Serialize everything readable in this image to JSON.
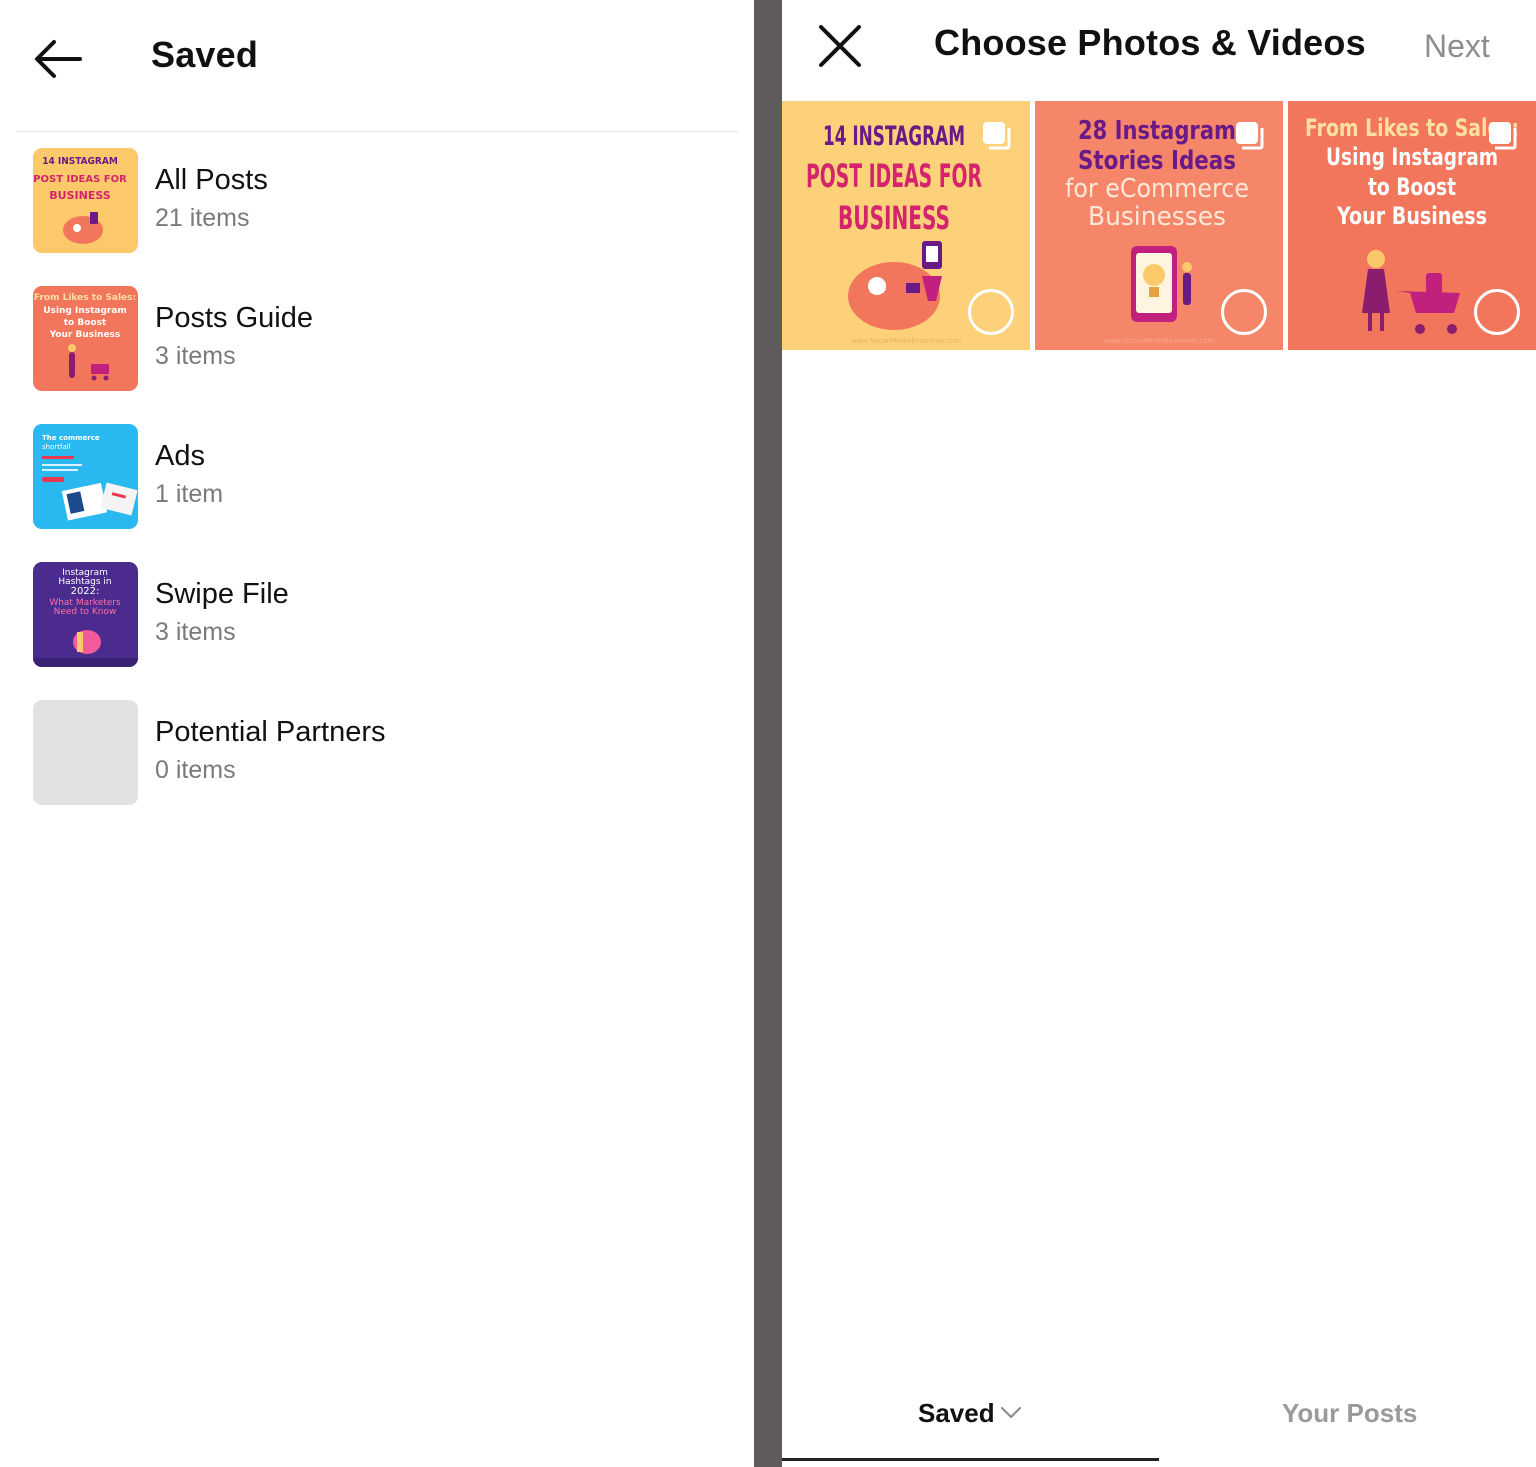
{
  "saved": {
    "title": "Saved",
    "back_icon": "arrow-left-icon",
    "collections": [
      {
        "name": "All Posts",
        "count": "21 items",
        "thumb": {
          "bg": "#fbc96a",
          "lines": [
            "14 INSTAGRAM",
            "POST IDEAS FOR",
            "BUSINESS"
          ],
          "text_color": "#6a1a86"
        }
      },
      {
        "name": "Posts Guide",
        "count": "3 items",
        "thumb": {
          "bg": "#f2765b",
          "lines": [
            "From Likes to Sales:",
            "Using Instagram",
            "to Boost",
            "Your Business"
          ],
          "text_color": "#ffffff"
        }
      },
      {
        "name": "Ads",
        "count": "1 item",
        "thumb": {
          "bg": "#29b9f0",
          "lines": [
            "The commerce",
            "shortfall"
          ],
          "text_color": "#ffffff"
        }
      },
      {
        "name": "Swipe File",
        "count": "3 items",
        "thumb": {
          "bg": "#4b2c8e",
          "lines": [
            "Instagram",
            "Hashtags in",
            "2022:",
            "What Marketers",
            "Need to Know"
          ],
          "text_color": "#ffffff"
        }
      },
      {
        "name": "Potential Partners",
        "count": "0 items",
        "thumb": {
          "bg": "#e2e2e2",
          "lines": [],
          "text_color": "#e2e2e2"
        }
      }
    ]
  },
  "chooser": {
    "title": "Choose Photos & Videos",
    "next_label": "Next",
    "close_icon": "close-icon",
    "tiles": [
      {
        "bg": "#fdd07a",
        "lines": [
          "14 INSTAGRAM",
          "POST IDEAS FOR",
          "BUSINESS"
        ],
        "text_color": "#6a1a86",
        "footer": "www.SocialMediaExaminer.com"
      },
      {
        "bg": "#f5866a",
        "lines": [
          "28 Instagram",
          "Stories Ideas",
          "for eCommerce",
          "Businesses"
        ],
        "text_color": "#6a1a86",
        "footer": "www.SocialMediaExaminer.com"
      },
      {
        "bg": "#f2765b",
        "lines": [
          "From Likes to Sales:",
          "Using Instagram",
          "to Boost",
          "Your Business"
        ],
        "text_color": "#ffffff",
        "footer": ""
      }
    ],
    "tabs": [
      {
        "label": "Saved",
        "active": true
      },
      {
        "label": "Your Posts",
        "active": false
      }
    ]
  }
}
